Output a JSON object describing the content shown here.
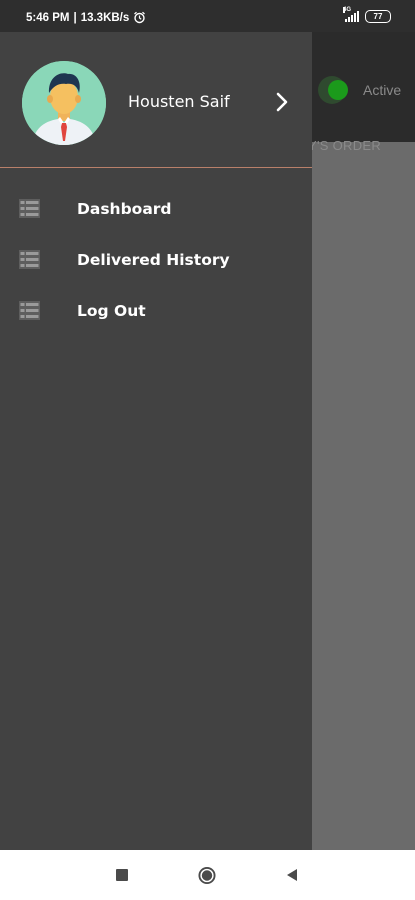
{
  "status_bar": {
    "time": "5:46 PM",
    "separator": "|",
    "network_speed": "13.3KB/s",
    "alarm_icon": "alarm-icon",
    "signal_label": "4G",
    "battery_level": "77"
  },
  "background_app": {
    "status_text": "Active",
    "tab_text": "Y'S ORDER",
    "toggle_color": "#1b9a1b"
  },
  "drawer": {
    "profile": {
      "name": "Housten Saif",
      "avatar_icon": "user-avatar-icon",
      "chevron_icon": "chevron-right-icon"
    },
    "divider_color": "#b9806a",
    "menu_items": [
      {
        "label": "Dashboard",
        "icon": "list-icon"
      },
      {
        "label": "Delivered History",
        "icon": "list-icon"
      },
      {
        "label": "Log Out",
        "icon": "list-icon"
      }
    ]
  },
  "navigation_bar": {
    "recent_icon": "square-icon",
    "home_icon": "circle-icon",
    "back_icon": "triangle-back-icon"
  },
  "colors": {
    "drawer_bg": "#424242",
    "scrim": "#6b6b6b",
    "status_bar_bg": "#2e2e2e"
  }
}
